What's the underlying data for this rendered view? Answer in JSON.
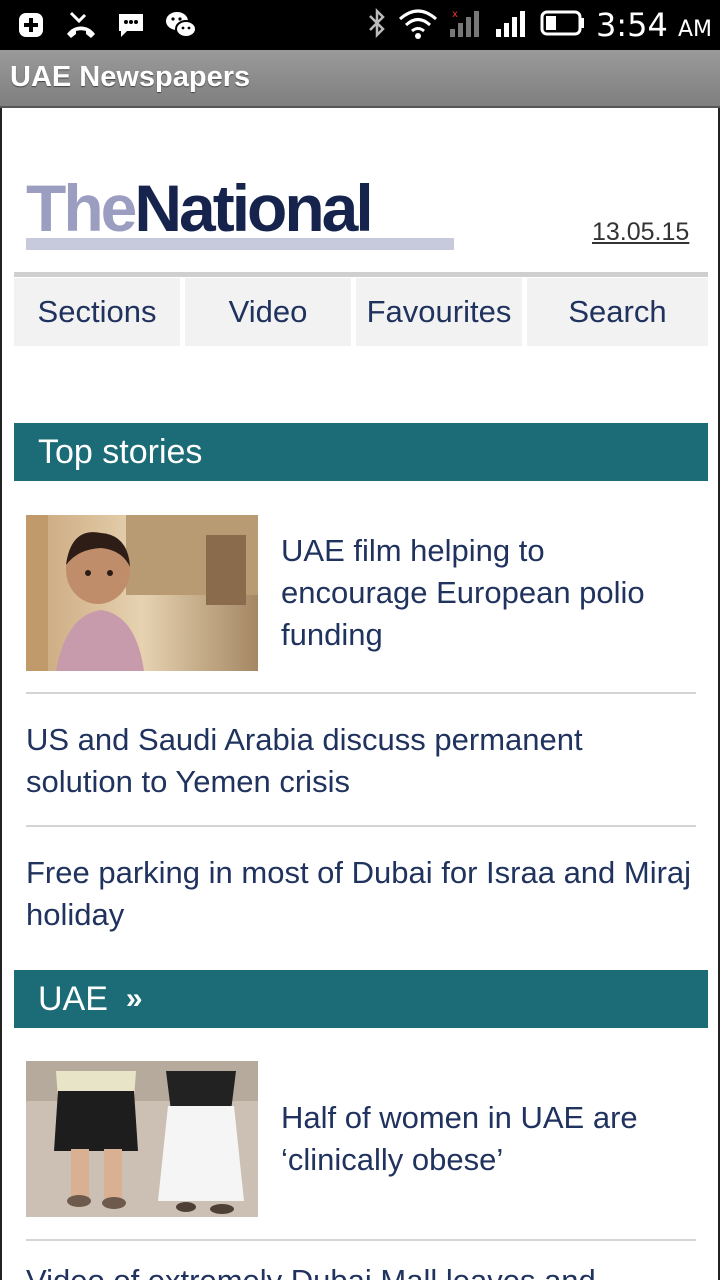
{
  "status_bar": {
    "time": "3:54",
    "ampm": "AM",
    "icons": [
      "add-square-icon",
      "missed-call-icon",
      "chat-bubble-icon",
      "wechat-icon",
      "bluetooth-icon",
      "wifi-icon",
      "signal-icon",
      "signal-2-icon",
      "battery-icon"
    ]
  },
  "app_bar": {
    "title": "UAE Newspapers"
  },
  "header": {
    "logo_part1": "The",
    "logo_part2": "National",
    "date": "13.05.15"
  },
  "nav": [
    "Sections",
    "Video",
    "Favourites",
    "Search"
  ],
  "sections": {
    "top_stories": {
      "title": "Top stories",
      "stories": [
        {
          "title": "UAE film helping to encourage European polio funding",
          "has_image": true
        },
        {
          "title": "US and Saudi Arabia discuss permanent solution to Yemen crisis"
        },
        {
          "title": "Free parking in most of Dubai for Israa and Miraj holiday"
        }
      ]
    },
    "uae": {
      "title": "UAE",
      "chevron": "»",
      "stories": [
        {
          "title": "Half of women in UAE are ‘clinically obese’",
          "has_image": true
        },
        {
          "title": "Video of extremely Dubai Mall leaves and..."
        }
      ]
    }
  },
  "colors": {
    "band": "#1b6c76",
    "link_text": "#20325e",
    "logo_the": "#9b9ec0",
    "logo_national": "#15234d"
  }
}
